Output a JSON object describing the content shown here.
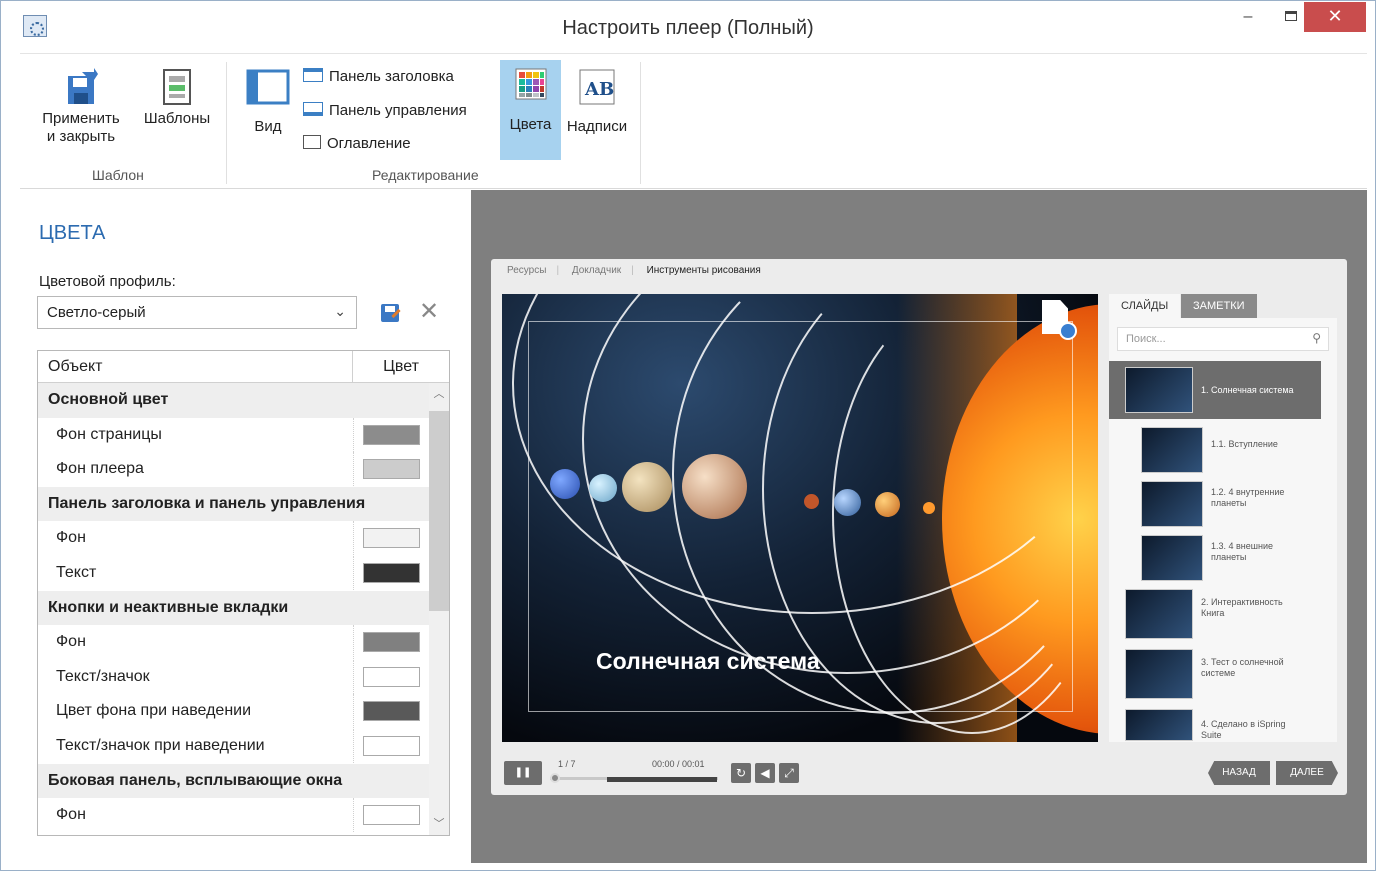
{
  "window": {
    "title": "Настроить плеер (Полный)",
    "minimize_glyph": "–",
    "close_glyph": "✕"
  },
  "ribbon": {
    "apply_line1": "Применить",
    "apply_line2": "и закрыть",
    "templates_label": "Шаблоны",
    "group_template": "Шаблон",
    "view_label": "Вид",
    "title_panel": "Панель заголовка",
    "control_panel": "Панель управления",
    "toc": "Оглавление",
    "colors_label": "Цвета",
    "captions_label": "Надписи",
    "group_editing": "Редактирование"
  },
  "panel": {
    "title": "ЦВЕТА",
    "profile_label": "Цветовой профиль:",
    "profile_value": "Светло-серый",
    "col_object": "Объект",
    "col_color": "Цвет",
    "rows": [
      {
        "type": "group",
        "label": "Основной цвет"
      },
      {
        "type": "item",
        "label": "Фон страницы",
        "color": "#8c8c8c"
      },
      {
        "type": "item",
        "label": "Фон плеера",
        "color": "#cccccc"
      },
      {
        "type": "group",
        "label": "Панель заголовка и панель управления"
      },
      {
        "type": "item",
        "label": "Фон",
        "color": "#f2f2f2"
      },
      {
        "type": "item",
        "label": "Текст",
        "color": "#333333"
      },
      {
        "type": "group",
        "label": "Кнопки и неактивные вкладки"
      },
      {
        "type": "item",
        "label": "Фон",
        "color": "#808080"
      },
      {
        "type": "item",
        "label": "Текст/значок",
        "color": "#ffffff"
      },
      {
        "type": "item",
        "label": "Цвет фона при наведении",
        "color": "#595959"
      },
      {
        "type": "item",
        "label": "Текст/значок при наведении",
        "color": "#ffffff"
      },
      {
        "type": "group",
        "label": "Боковая панель, всплывающие окна"
      },
      {
        "type": "item",
        "label": "Фон",
        "color": "#ffffff"
      }
    ]
  },
  "player": {
    "tabs": [
      "Ресурсы",
      "Докладчик",
      "Инструменты рисования"
    ],
    "slide_title": "Солнечная система",
    "side_tab_slides": "СЛАЙДЫ",
    "side_tab_notes": "ЗАМЕТКИ",
    "search_placeholder": "Поиск...",
    "outline": [
      {
        "label": "1. Солнечная система",
        "selected": true
      },
      {
        "label": "1.1. Вступление"
      },
      {
        "label": "1.2. 4 внутренние",
        "label2": "планеты"
      },
      {
        "label": "1.3. 4 внешние",
        "label2": "планеты"
      },
      {
        "label": "2. Интерактивность",
        "label2": "Книга"
      },
      {
        "label": "3. Тест о солнечной",
        "label2": "системе"
      },
      {
        "label": "4. Сделано в iSpring",
        "label2": "Suite"
      }
    ],
    "counter": "1 / 7",
    "time": "00:00 / 00:01",
    "back_label": "НАЗАД",
    "next_label": "ДАЛЕЕ",
    "progress": 0
  },
  "colors": {
    "accent": "#2c6bb0",
    "selected_ribbon": "#a7d2ef",
    "close_button": "#c94d4d"
  }
}
